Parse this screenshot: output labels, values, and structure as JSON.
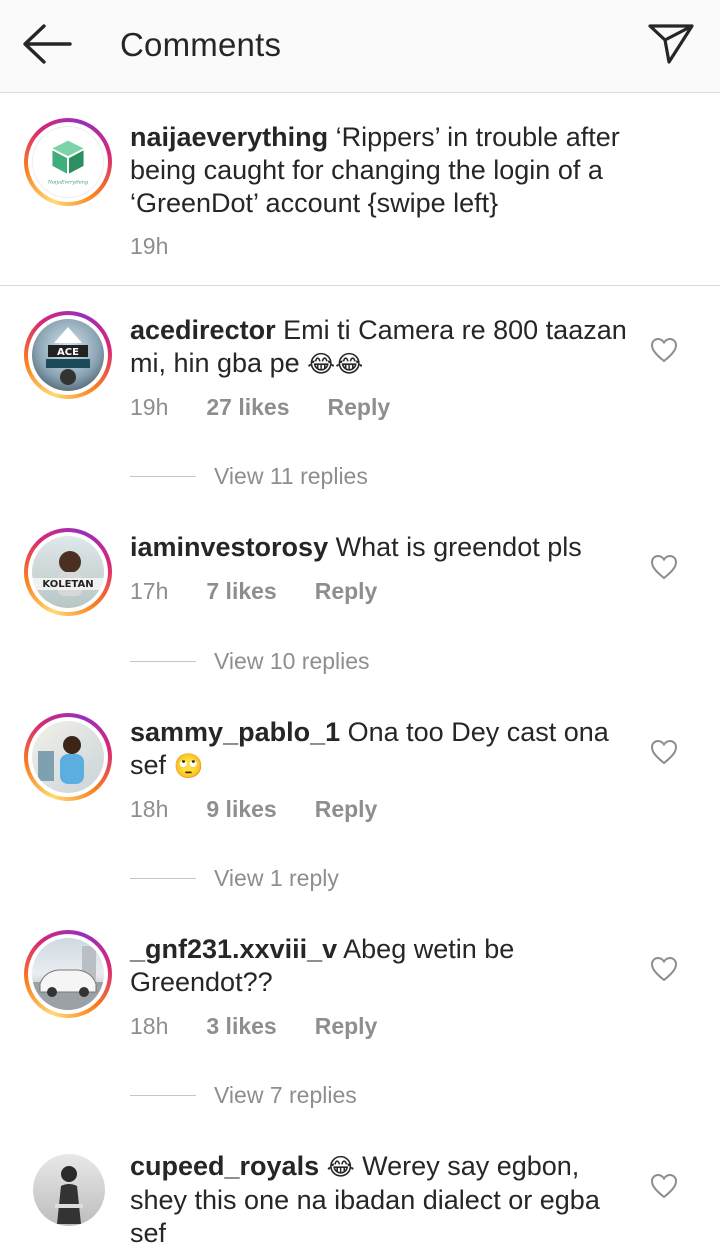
{
  "header": {
    "title": "Comments",
    "back_icon": "arrow-left-icon",
    "direct_icon": "paper-plane-icon"
  },
  "caption": {
    "username": "naijaeverything",
    "text": "‘Rippers’ in trouble after being caught for changing the login of a ‘GreenDot’ account {swipe left}",
    "time": "19h",
    "logo_text": "NaijaEverything"
  },
  "comments": [
    {
      "username": "acedirector",
      "text": "Emi ti Camera re 800 taazan mi, hin gba pe",
      "emoji": "😂😂",
      "time": "19h",
      "likes": "27 likes",
      "reply": "Reply",
      "view_replies": "View 11 replies",
      "avatar_text": "ACE"
    },
    {
      "username": "iaminvestorosy",
      "text": "What is greendot pls",
      "emoji": "",
      "time": "17h",
      "likes": "7 likes",
      "reply": "Reply",
      "view_replies": "View 10 replies",
      "avatar_text": "KOLETAN"
    },
    {
      "username": "sammy_pablo_1",
      "text": "Ona too Dey cast ona sef",
      "emoji": "🙄",
      "time": "18h",
      "likes": "9 likes",
      "reply": "Reply",
      "view_replies": "View 1 reply"
    },
    {
      "username": "_gnf231.xxviii_v",
      "text": "Abeg wetin be Greendot??",
      "emoji": "",
      "time": "18h",
      "likes": "3 likes",
      "reply": "Reply",
      "view_replies": "View 7 replies"
    },
    {
      "username": "cupeed_royals",
      "emoji_lead": "😂",
      "text": "Werey say egbon, shey this one na ibadan dialect or egba sef"
    }
  ],
  "colors": {
    "text": "#262626",
    "muted": "#8e8e8e",
    "divider": "#dbdbdb",
    "header_bg": "#fafafa"
  }
}
